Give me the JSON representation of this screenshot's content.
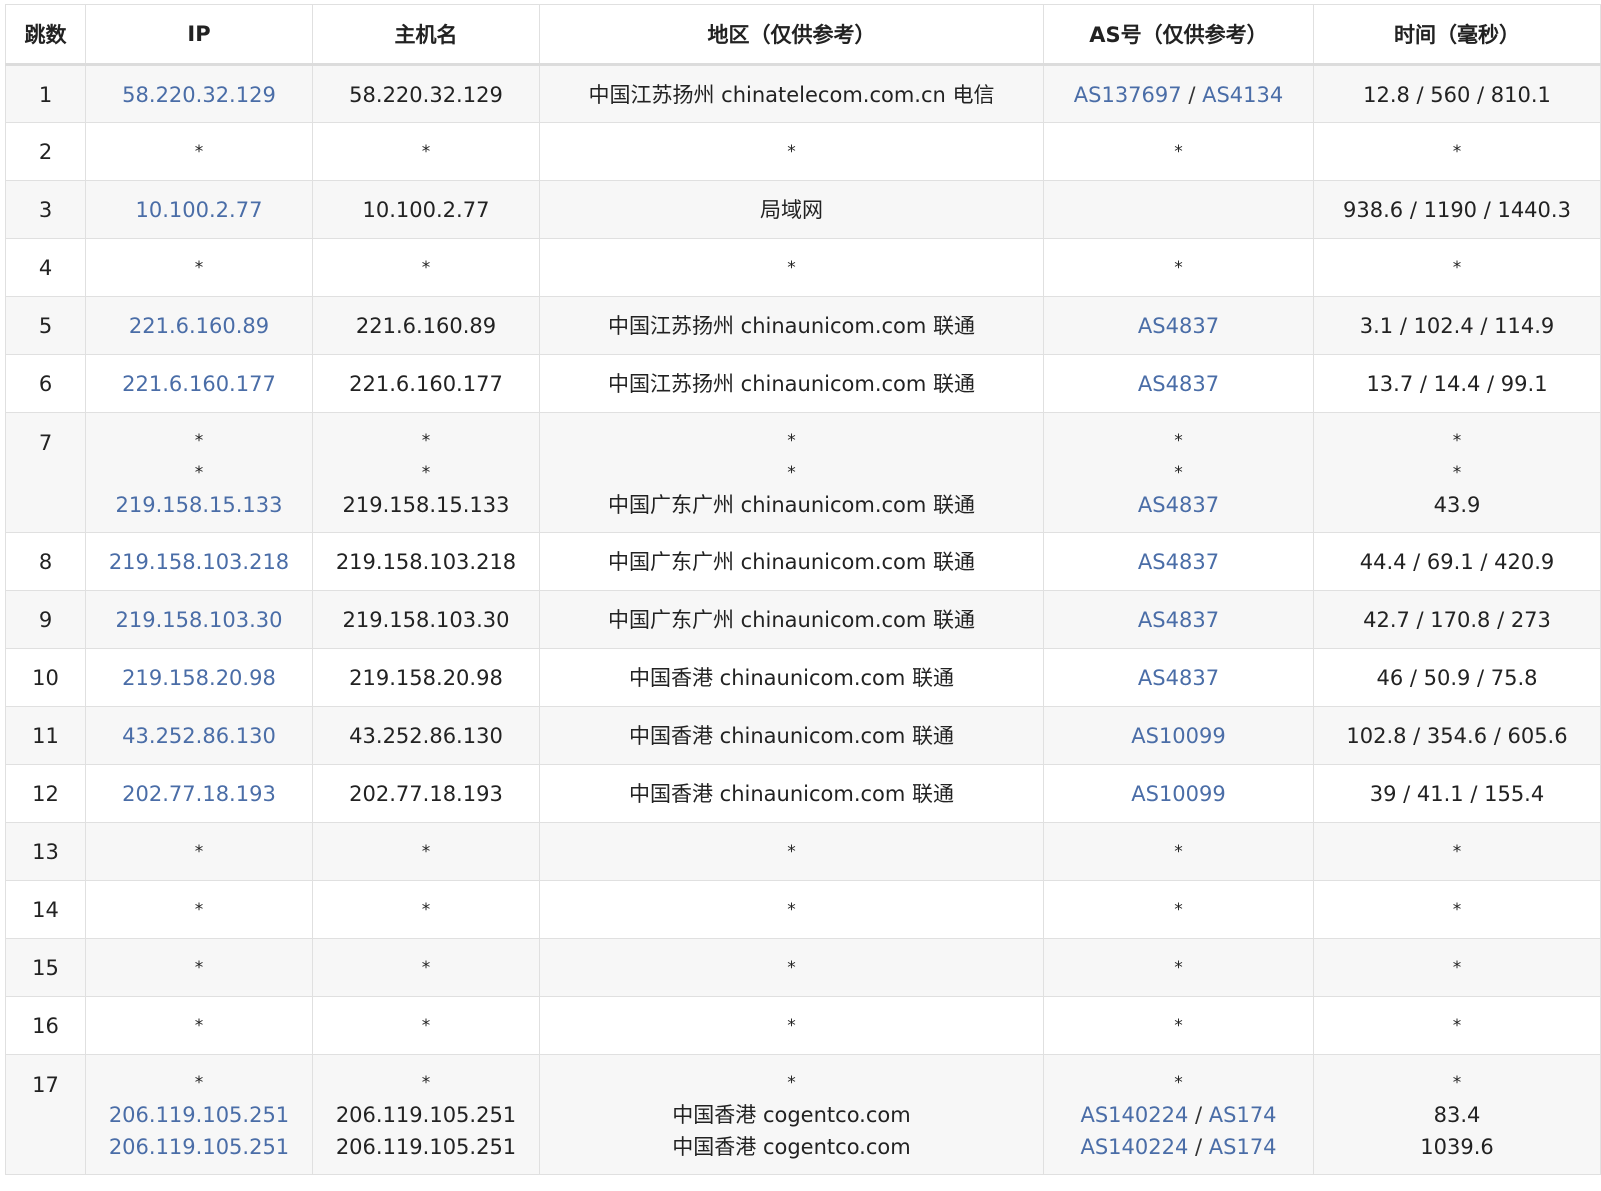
{
  "headers": [
    "跳数",
    "IP",
    "主机名",
    "地区（仅供参考）",
    "AS号（仅供参考）",
    "时间（毫秒）"
  ],
  "rows": [
    {
      "hop": "1",
      "lines": [
        {
          "ip": "58.220.32.129",
          "host": "58.220.32.129",
          "region": "中国江苏扬州 chinatelecom.com.cn 电信",
          "as": [
            "AS137697",
            "AS4134"
          ],
          "time": "12.8 / 560 / 810.1"
        }
      ]
    },
    {
      "hop": "2",
      "lines": [
        {
          "ip": "*",
          "host": "*",
          "region": "*",
          "as": [
            "*"
          ],
          "time": "*"
        }
      ]
    },
    {
      "hop": "3",
      "lines": [
        {
          "ip": "10.100.2.77",
          "host": "10.100.2.77",
          "region": "局域网",
          "as": [],
          "time": "938.6 / 1190 / 1440.3"
        }
      ]
    },
    {
      "hop": "4",
      "lines": [
        {
          "ip": "*",
          "host": "*",
          "region": "*",
          "as": [
            "*"
          ],
          "time": "*"
        }
      ]
    },
    {
      "hop": "5",
      "lines": [
        {
          "ip": "221.6.160.89",
          "host": "221.6.160.89",
          "region": "中国江苏扬州 chinaunicom.com 联通",
          "as": [
            "AS4837"
          ],
          "time": "3.1 / 102.4 / 114.9"
        }
      ]
    },
    {
      "hop": "6",
      "lines": [
        {
          "ip": "221.6.160.177",
          "host": "221.6.160.177",
          "region": "中国江苏扬州 chinaunicom.com 联通",
          "as": [
            "AS4837"
          ],
          "time": "13.7 / 14.4 / 99.1"
        }
      ]
    },
    {
      "hop": "7",
      "lines": [
        {
          "ip": "*",
          "host": "*",
          "region": "*",
          "as": [
            "*"
          ],
          "time": "*"
        },
        {
          "ip": "*",
          "host": "*",
          "region": "*",
          "as": [
            "*"
          ],
          "time": "*"
        },
        {
          "ip": "219.158.15.133",
          "host": "219.158.15.133",
          "region": "中国广东广州 chinaunicom.com 联通",
          "as": [
            "AS4837"
          ],
          "time": "43.9"
        }
      ]
    },
    {
      "hop": "8",
      "lines": [
        {
          "ip": "219.158.103.218",
          "host": "219.158.103.218",
          "region": "中国广东广州 chinaunicom.com 联通",
          "as": [
            "AS4837"
          ],
          "time": "44.4 / 69.1 / 420.9"
        }
      ]
    },
    {
      "hop": "9",
      "lines": [
        {
          "ip": "219.158.103.30",
          "host": "219.158.103.30",
          "region": "中国广东广州 chinaunicom.com 联通",
          "as": [
            "AS4837"
          ],
          "time": "42.7 / 170.8 / 273"
        }
      ]
    },
    {
      "hop": "10",
      "lines": [
        {
          "ip": "219.158.20.98",
          "host": "219.158.20.98",
          "region": "中国香港 chinaunicom.com 联通",
          "as": [
            "AS4837"
          ],
          "time": "46 / 50.9 / 75.8"
        }
      ]
    },
    {
      "hop": "11",
      "lines": [
        {
          "ip": "43.252.86.130",
          "host": "43.252.86.130",
          "region": "中国香港 chinaunicom.com 联通",
          "as": [
            "AS10099"
          ],
          "time": "102.8 / 354.6 / 605.6"
        }
      ]
    },
    {
      "hop": "12",
      "lines": [
        {
          "ip": "202.77.18.193",
          "host": "202.77.18.193",
          "region": "中国香港 chinaunicom.com 联通",
          "as": [
            "AS10099"
          ],
          "time": "39 / 41.1 / 155.4"
        }
      ]
    },
    {
      "hop": "13",
      "lines": [
        {
          "ip": "*",
          "host": "*",
          "region": "*",
          "as": [
            "*"
          ],
          "time": "*"
        }
      ]
    },
    {
      "hop": "14",
      "lines": [
        {
          "ip": "*",
          "host": "*",
          "region": "*",
          "as": [
            "*"
          ],
          "time": "*"
        }
      ]
    },
    {
      "hop": "15",
      "lines": [
        {
          "ip": "*",
          "host": "*",
          "region": "*",
          "as": [
            "*"
          ],
          "time": "*"
        }
      ]
    },
    {
      "hop": "16",
      "lines": [
        {
          "ip": "*",
          "host": "*",
          "region": "*",
          "as": [
            "*"
          ],
          "time": "*"
        }
      ]
    },
    {
      "hop": "17",
      "lines": [
        {
          "ip": "*",
          "host": "*",
          "region": "*",
          "as": [
            "*"
          ],
          "time": "*"
        },
        {
          "ip": "206.119.105.251",
          "host": "206.119.105.251",
          "region": "中国香港 cogentco.com",
          "as": [
            "AS140224",
            "AS174"
          ],
          "time": "83.4"
        },
        {
          "ip": "206.119.105.251",
          "host": "206.119.105.251",
          "region": "中国香港 cogentco.com",
          "as": [
            "AS140224",
            "AS174"
          ],
          "time": "1039.6"
        }
      ]
    }
  ],
  "colors": {
    "link": "#4a6da7",
    "row_odd": "#f7f7f7",
    "row_even": "#ffffff",
    "border": "#e0e0e0"
  }
}
